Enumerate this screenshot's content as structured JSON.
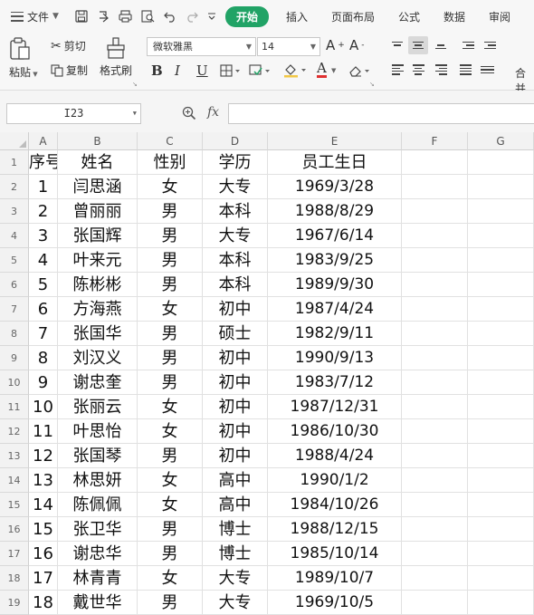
{
  "menubar": {
    "file_label": "文件",
    "tabs": [
      "开始",
      "插入",
      "页面布局",
      "公式",
      "数据",
      "审阅"
    ],
    "active_tab": "开始"
  },
  "ribbon": {
    "paste_label": "粘贴",
    "cut_label": "剪切",
    "copy_label": "复制",
    "format_painter_label": "格式刷",
    "font_name": "微软雅黑",
    "font_size": "14",
    "merge_label": "合并"
  },
  "formula_bar": {
    "cell_ref": "I23",
    "fx_label": "fx",
    "formula": ""
  },
  "grid": {
    "columns": [
      "A",
      "B",
      "C",
      "D",
      "E",
      "F",
      "G"
    ],
    "rows": [
      {
        "num": "1",
        "cells": [
          "序号",
          "姓名",
          "性别",
          "学历",
          "员工生日",
          "",
          ""
        ]
      },
      {
        "num": "2",
        "cells": [
          "1",
          "闫思涵",
          "女",
          "大专",
          "1969/3/28",
          "",
          ""
        ]
      },
      {
        "num": "3",
        "cells": [
          "2",
          "曾丽丽",
          "男",
          "本科",
          "1988/8/29",
          "",
          ""
        ]
      },
      {
        "num": "4",
        "cells": [
          "3",
          "张国辉",
          "男",
          "大专",
          "1967/6/14",
          "",
          ""
        ]
      },
      {
        "num": "5",
        "cells": [
          "4",
          "叶来元",
          "男",
          "本科",
          "1983/9/25",
          "",
          ""
        ]
      },
      {
        "num": "6",
        "cells": [
          "5",
          "陈彬彬",
          "男",
          "本科",
          "1989/9/30",
          "",
          ""
        ]
      },
      {
        "num": "7",
        "cells": [
          "6",
          "方海燕",
          "女",
          "初中",
          "1987/4/24",
          "",
          ""
        ]
      },
      {
        "num": "8",
        "cells": [
          "7",
          "张国华",
          "男",
          "硕士",
          "1982/9/11",
          "",
          ""
        ]
      },
      {
        "num": "9",
        "cells": [
          "8",
          "刘汉义",
          "男",
          "初中",
          "1990/9/13",
          "",
          ""
        ]
      },
      {
        "num": "10",
        "cells": [
          "9",
          "谢忠奎",
          "男",
          "初中",
          "1983/7/12",
          "",
          ""
        ]
      },
      {
        "num": "11",
        "cells": [
          "10",
          "张丽云",
          "女",
          "初中",
          "1987/12/31",
          "",
          ""
        ]
      },
      {
        "num": "12",
        "cells": [
          "11",
          "叶思怡",
          "女",
          "初中",
          "1986/10/30",
          "",
          ""
        ]
      },
      {
        "num": "13",
        "cells": [
          "12",
          "张国琴",
          "男",
          "初中",
          "1988/4/24",
          "",
          ""
        ]
      },
      {
        "num": "14",
        "cells": [
          "13",
          "林思妍",
          "女",
          "高中",
          "1990/1/2",
          "",
          ""
        ]
      },
      {
        "num": "15",
        "cells": [
          "14",
          "陈佩佩",
          "女",
          "高中",
          "1984/10/26",
          "",
          ""
        ]
      },
      {
        "num": "16",
        "cells": [
          "15",
          "张卫华",
          "男",
          "博士",
          "1988/12/15",
          "",
          ""
        ]
      },
      {
        "num": "17",
        "cells": [
          "16",
          "谢忠华",
          "男",
          "博士",
          "1985/10/14",
          "",
          ""
        ]
      },
      {
        "num": "18",
        "cells": [
          "17",
          "林青青",
          "女",
          "大专",
          "1989/10/7",
          "",
          ""
        ]
      },
      {
        "num": "19",
        "cells": [
          "18",
          "戴世华",
          "男",
          "大专",
          "1969/10/5",
          "",
          ""
        ]
      }
    ]
  },
  "colors": {
    "active_tab_bg": "#21a366",
    "header_bg": "#f2f2f2",
    "gridline": "#e1e1e1"
  }
}
